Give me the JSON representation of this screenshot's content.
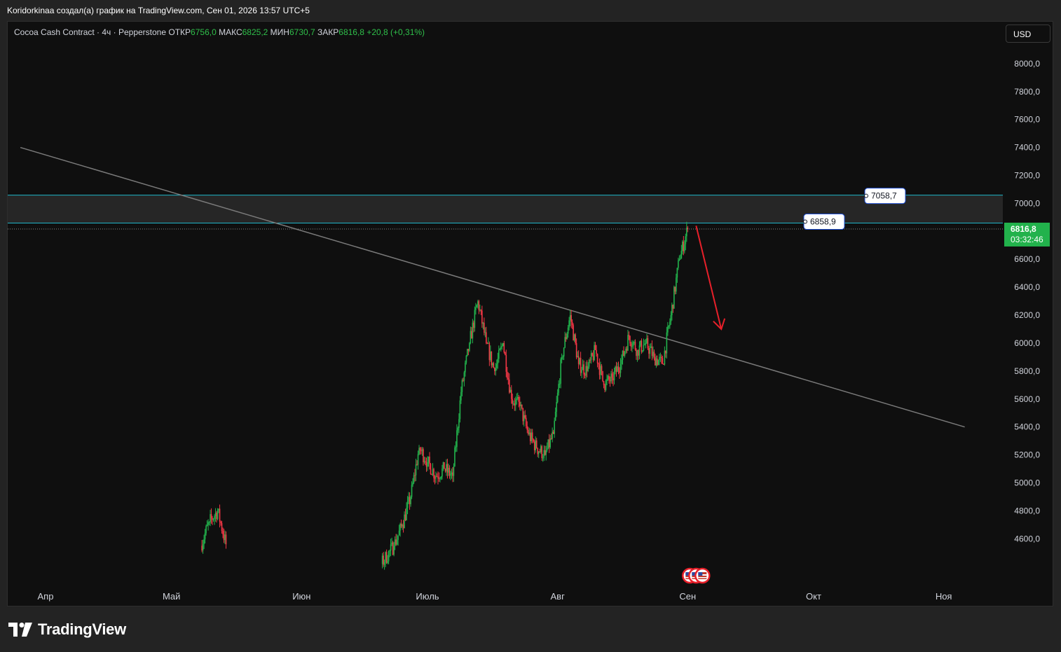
{
  "caption": "Koridorkinaa создал(а) график на TradingView.com, Сен 01, 2026 13:57 UTC+5",
  "legend": {
    "symbol": "Cocoa Cash Contract · 4ч · Pepperstone",
    "open_label": "ОТКР",
    "open": "6756,0",
    "high_label": "МАКС",
    "high": "6825,2",
    "low_label": "МИН",
    "low": "6730,7",
    "close_label": "ЗАКР",
    "close": "6816,8",
    "change": "+20,8 (+0,31%)"
  },
  "currency_button": "USD",
  "brand": "TradingView",
  "colors": {
    "background": "#0f0f0f",
    "up": "#22b24c",
    "down": "#f23645",
    "zone_line": "#1fb5c9",
    "trendline": "#7a7a7a",
    "arrow": "#e8202a",
    "price_tag": "#22b24c"
  },
  "chart_data": {
    "type": "candlestick",
    "ylim": [
      4400,
      8200
    ],
    "y_ticks": [
      "8000,0",
      "7800,0",
      "7600,0",
      "7400,0",
      "7200,0",
      "7000,0",
      "6600,0",
      "6400,0",
      "6200,0",
      "6000,0",
      "5800,0",
      "5600,0",
      "5400,0",
      "5200,0",
      "5000,0",
      "4800,0",
      "4600,0"
    ],
    "y_tick_values": [
      8000,
      7800,
      7600,
      7400,
      7200,
      7000,
      6600,
      6400,
      6200,
      6000,
      5800,
      5600,
      5400,
      5200,
      5000,
      4800,
      4600
    ],
    "x_labels": [
      "Апр",
      "Май",
      "Июн",
      "Июль",
      "Авг",
      "Сен",
      "Окт",
      "Ноя"
    ],
    "x_label_dates": [
      "2026-04-01",
      "2026-05-01",
      "2026-06-01",
      "2026-07-01",
      "2026-08-01",
      "2026-09-01",
      "2026-10-01",
      "2026-11-01"
    ],
    "close_series_approx": [
      {
        "date": "2026-05-08",
        "close": 4550
      },
      {
        "date": "2026-05-10",
        "close": 4720
      },
      {
        "date": "2026-05-12",
        "close": 4800
      },
      {
        "date": "2026-05-14",
        "close": 4560
      },
      {
        "date": "2026-06-20",
        "close": 4420
      },
      {
        "date": "2026-06-23",
        "close": 4550
      },
      {
        "date": "2026-06-25",
        "close": 4700
      },
      {
        "date": "2026-06-27",
        "close": 4900
      },
      {
        "date": "2026-06-29",
        "close": 5250
      },
      {
        "date": "2026-07-01",
        "close": 5150
      },
      {
        "date": "2026-07-03",
        "close": 5050
      },
      {
        "date": "2026-07-05",
        "close": 5100
      },
      {
        "date": "2026-07-07",
        "close": 5050
      },
      {
        "date": "2026-07-09",
        "close": 5650
      },
      {
        "date": "2026-07-11",
        "close": 6000
      },
      {
        "date": "2026-07-13",
        "close": 6300
      },
      {
        "date": "2026-07-15",
        "close": 6000
      },
      {
        "date": "2026-07-17",
        "close": 5800
      },
      {
        "date": "2026-07-19",
        "close": 6000
      },
      {
        "date": "2026-07-21",
        "close": 5600
      },
      {
        "date": "2026-07-23",
        "close": 5550
      },
      {
        "date": "2026-07-25",
        "close": 5350
      },
      {
        "date": "2026-07-27",
        "close": 5250
      },
      {
        "date": "2026-07-29",
        "close": 5200
      },
      {
        "date": "2026-07-31",
        "close": 5350
      },
      {
        "date": "2026-08-02",
        "close": 5900
      },
      {
        "date": "2026-08-04",
        "close": 6200
      },
      {
        "date": "2026-08-06",
        "close": 5850
      },
      {
        "date": "2026-08-08",
        "close": 5800
      },
      {
        "date": "2026-08-10",
        "close": 5950
      },
      {
        "date": "2026-08-12",
        "close": 5700
      },
      {
        "date": "2026-08-14",
        "close": 5750
      },
      {
        "date": "2026-08-16",
        "close": 5850
      },
      {
        "date": "2026-08-18",
        "close": 6050
      },
      {
        "date": "2026-08-20",
        "close": 5950
      },
      {
        "date": "2026-08-22",
        "close": 6000
      },
      {
        "date": "2026-08-24",
        "close": 5900
      },
      {
        "date": "2026-08-26",
        "close": 5850
      },
      {
        "date": "2026-08-28",
        "close": 6200
      },
      {
        "date": "2026-08-30",
        "close": 6600
      },
      {
        "date": "2026-09-01",
        "close": 6816.8
      }
    ],
    "zone": {
      "upper": 7058.7,
      "lower": 6858.9,
      "upper_label": "7058,7",
      "lower_label": "6858,9"
    },
    "trendline": {
      "from": {
        "date": "2026-03-26",
        "price": 7400
      },
      "to": {
        "date": "2026-11-06",
        "price": 5400
      }
    },
    "projection_arrow": {
      "from": {
        "date": "2026-09-03",
        "price": 6840
      },
      "to": {
        "date": "2026-09-09",
        "price": 6100
      }
    },
    "last_price": {
      "value": 6816.8,
      "label": "6816,8",
      "timer": "03:32:46"
    },
    "event_markers_date": "2026-09-01"
  }
}
